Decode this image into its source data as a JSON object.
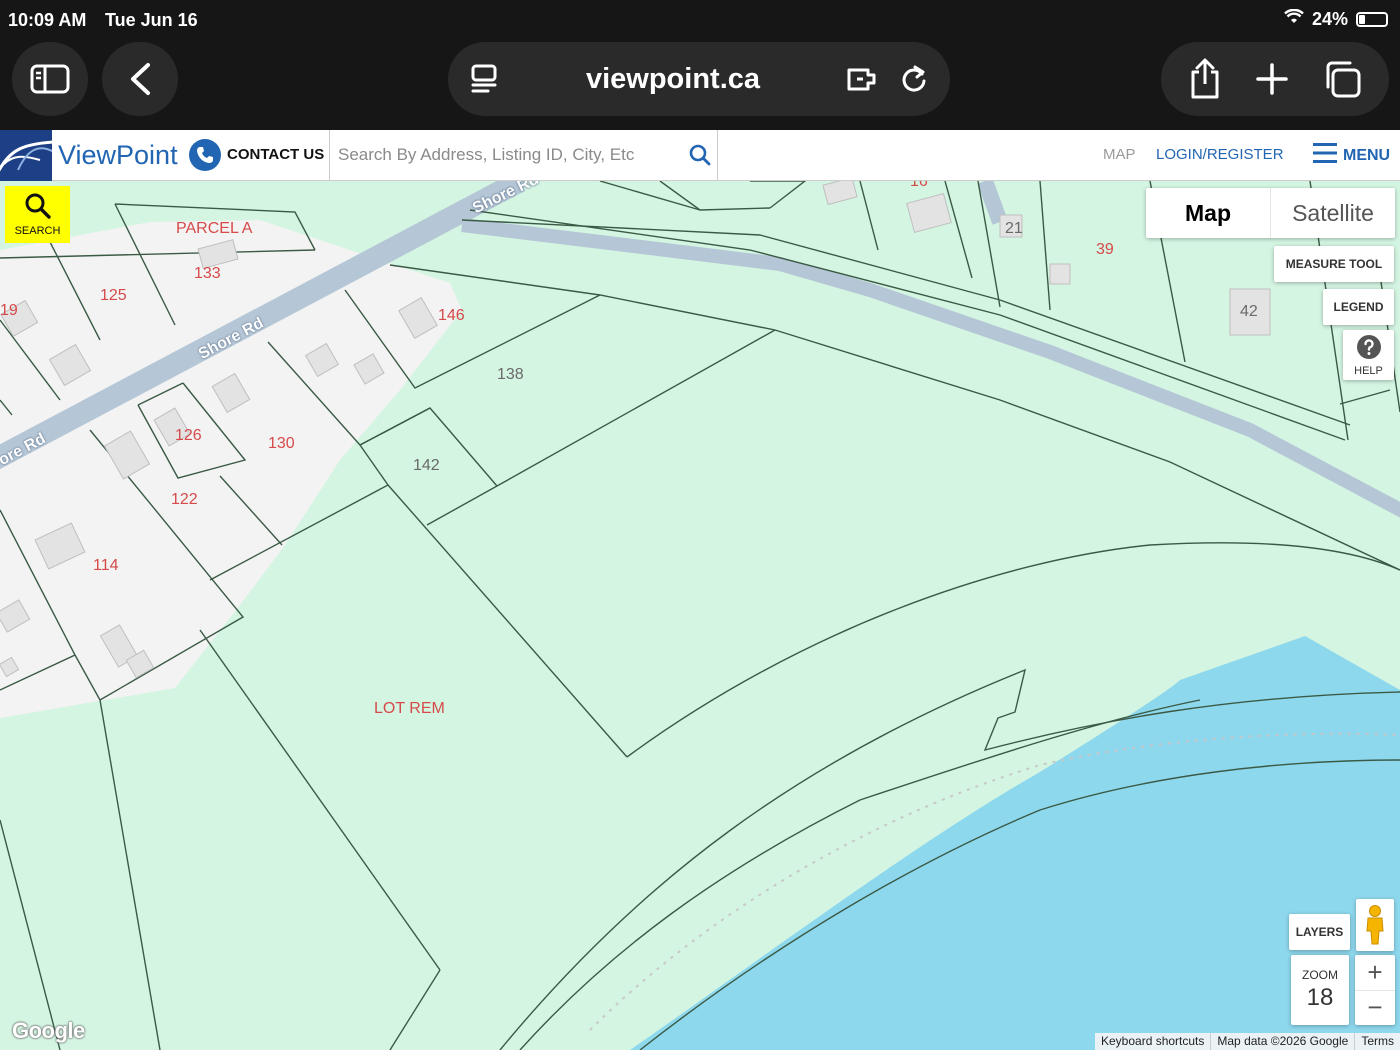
{
  "status_bar": {
    "time": "10:09 AM",
    "date": "Tue Jun 16",
    "battery": "24%"
  },
  "browser": {
    "url": "viewpoint.ca"
  },
  "header": {
    "logo_text": "ViewPoint",
    "contact_label": "CONTACT US",
    "search_placeholder": "Search By Address, Listing ID, City, Etc",
    "nav_map": "MAP",
    "nav_login": "LOGIN/REGISTER",
    "nav_menu": "MENU"
  },
  "controls": {
    "search_label": "SEARCH",
    "map_type_map": "Map",
    "map_type_satellite": "Satellite",
    "measure_tool": "MEASURE TOOL",
    "legend": "LEGEND",
    "help": "HELP",
    "layers": "LAYERS",
    "zoom_label": "ZOOM",
    "zoom_value": "18",
    "zoom_in": "+",
    "zoom_out": "−"
  },
  "map": {
    "lot_labels": [
      "PARCEL A",
      "133",
      "125",
      "19",
      "146",
      "138",
      "126",
      "130",
      "142",
      "122",
      "114",
      "LOT REM",
      "16",
      "21",
      "39",
      "42"
    ],
    "road_labels": [
      "Shore Rd",
      "Shore Rd",
      "ore Rd"
    ],
    "google_logo": "Google",
    "attribution": [
      "Keyboard shortcuts",
      "Map data ©2026 Google",
      "Terms"
    ]
  },
  "colors": {
    "land": "#d4f5e2",
    "water": "#8ed8ee",
    "road": "#b5c7d6",
    "built_area": "#f3f3f3",
    "lot_label": "#d64a4a",
    "brand_blue": "#2265b3",
    "search_button": "#ffff00"
  }
}
